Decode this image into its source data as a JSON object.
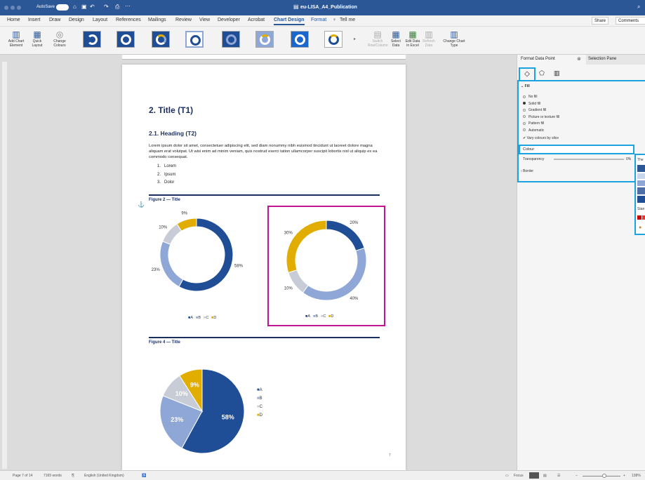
{
  "window": {
    "autosave": "AutoSave",
    "toggle": "OFF",
    "title": "eu-LISA_A4_Publication"
  },
  "menu": [
    "Home",
    "Insert",
    "Draw",
    "Design",
    "Layout",
    "References",
    "Mailings",
    "Review",
    "View",
    "Developer",
    "Acrobat",
    "Chart Design",
    "Format",
    "Tell me"
  ],
  "share": {
    "share": "Share",
    "comments": "Comments"
  },
  "ribbon": {
    "add_chart_element": "Add Chart Element",
    "quick_layout": "Quick Layout",
    "change_colours": "Change Colours",
    "switch": "Switch Row/Column",
    "select_data": "Select Data",
    "edit_data": "Edit Data in Excel",
    "refresh": "Refresh Data",
    "change_type": "Change Chart Type"
  },
  "doc": {
    "title": "2. Title (T1)",
    "heading": "2.1. Heading (T2)",
    "body": "Lorem ipsum dolor sit amet, consectetuer adipiscing elit, sed diam nonummy nibh euismod tincidunt ut laoreet dolore magna aliquam erat volutpat. Ut wisi enim ad minim veniam, quis nostrud exerci tation ullamcorper suscipit lobortis nisl ut aliquip ex ea commodo consequat.",
    "list": [
      "Lorem",
      "Ipsum",
      "Dolor"
    ],
    "fig2": "Figure 2 — Title",
    "fig4": "Figure 4 — Title",
    "page_number": "7"
  },
  "chart_data": [
    {
      "type": "pie",
      "variant": "donut",
      "categories": [
        "A",
        "B",
        "C",
        "D"
      ],
      "values": [
        58,
        23,
        10,
        9
      ],
      "labels": [
        "58%",
        "23%",
        "10%",
        "9%"
      ],
      "colors": [
        "#1f4e96",
        "#8ea7d6",
        "#c8ccd6",
        "#e0ad00"
      ],
      "legend": "bottom"
    },
    {
      "type": "pie",
      "variant": "donut",
      "categories": [
        "A",
        "B",
        "C",
        "D"
      ],
      "values": [
        20,
        40,
        10,
        30
      ],
      "labels": [
        "20%",
        "40%",
        "10%",
        "30%"
      ],
      "colors": [
        "#1f4e96",
        "#8ea7d6",
        "#c8ccd6",
        "#e0ad00"
      ],
      "legend": "bottom",
      "selected": true
    },
    {
      "type": "pie",
      "categories": [
        "A",
        "B",
        "C",
        "D"
      ],
      "values": [
        58,
        23,
        10,
        9
      ],
      "labels": [
        "58%",
        "23%",
        "10%",
        "9%"
      ],
      "colors": [
        "#1f4e96",
        "#8ea7d6",
        "#c8ccd6",
        "#e0ad00"
      ],
      "legend": "right"
    }
  ],
  "pane": {
    "format_title": "Format Data Point",
    "selection_title": "Selection Pane",
    "fill_section": "Fill",
    "fill_options": [
      "No fill",
      "Solid fill",
      "Gradient fill",
      "Picture or texture fill",
      "Pattern fill",
      "Automatic"
    ],
    "selected_fill": "Solid fill",
    "vary": "Vary colours by slice",
    "colour": "Colour",
    "transparency": "Transparency",
    "transparency_value": "0%",
    "border": "Border",
    "theme_colours": "The",
    "standard": "Stan"
  },
  "status": {
    "page": "Page 7 of 14",
    "words": "7165 words",
    "language": "English (United Kingdom)",
    "focus": "Focus",
    "zoom": "138%"
  }
}
